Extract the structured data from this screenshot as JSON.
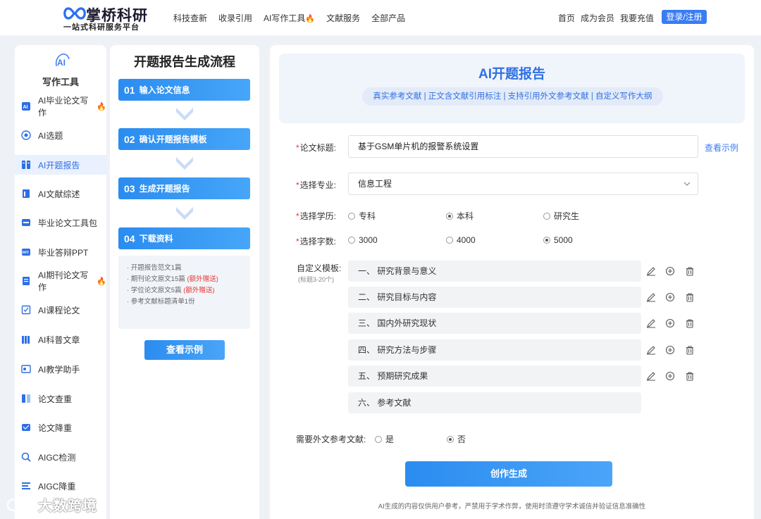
{
  "header": {
    "logo_name": "掌桥科研",
    "logo_slogan": "一站式科研服务平台",
    "nav": [
      {
        "label": "科技查新",
        "fire": false
      },
      {
        "label": "收录引用",
        "fire": false
      },
      {
        "label": "AI写作工具",
        "fire": true
      },
      {
        "label": "文献服务",
        "fire": false
      },
      {
        "label": "全部产品",
        "fire": false
      }
    ],
    "nav_right": [
      "首页",
      "成为会员",
      "我要充值"
    ],
    "login_label": "登录/注册",
    "fire_glyph": "🔥"
  },
  "sidebar": {
    "title": "写作工具",
    "items": [
      {
        "label": "AI毕业论文写作",
        "fire": true,
        "icon": "document-ai-icon",
        "active": false
      },
      {
        "label": "AI选题",
        "fire": false,
        "icon": "target-icon",
        "active": false
      },
      {
        "label": "AI开题报告",
        "fire": false,
        "icon": "report-icon",
        "active": true
      },
      {
        "label": "AI文献综述",
        "fire": false,
        "icon": "literature-icon",
        "active": false
      },
      {
        "label": "毕业论文工具包",
        "fire": false,
        "icon": "toolkit-icon",
        "active": false
      },
      {
        "label": "毕业答辩PPT",
        "fire": false,
        "icon": "ppt-icon",
        "active": false
      },
      {
        "label": "AI期刊论文写作",
        "fire": true,
        "icon": "journal-icon",
        "active": false
      },
      {
        "label": "AI课程论文",
        "fire": false,
        "icon": "course-icon",
        "active": false
      },
      {
        "label": "AI科普文章",
        "fire": false,
        "icon": "books-icon",
        "active": false
      },
      {
        "label": "AI教学助手",
        "fire": false,
        "icon": "teaching-icon",
        "active": false
      },
      {
        "label": "论文查重",
        "fire": false,
        "icon": "check-icon",
        "active": false
      },
      {
        "label": "论文降重",
        "fire": false,
        "icon": "reduce-icon",
        "active": false
      },
      {
        "label": "AIGC检测",
        "fire": false,
        "icon": "magnifier-icon",
        "active": false
      },
      {
        "label": "AIGC降重",
        "fire": false,
        "icon": "lines-icon",
        "active": false
      }
    ]
  },
  "process": {
    "title": "开题报告生成流程",
    "steps": [
      {
        "num": "01",
        "label": "输入论文信息"
      },
      {
        "num": "02",
        "label": "确认开题报告模板"
      },
      {
        "num": "03",
        "label": "生成开题报告"
      },
      {
        "num": "04",
        "label": "下载资料"
      }
    ],
    "resources": [
      {
        "text": "· 开题报告范文1篇",
        "extra": ""
      },
      {
        "text": "· 期刊论文原文15篇",
        "extra": "(额外赠送)"
      },
      {
        "text": "· 学位论文原文5篇",
        "extra": "(额外赠送)"
      },
      {
        "text": "· 参考文献标题清单1份",
        "extra": ""
      }
    ],
    "example_button": "查看示例"
  },
  "main": {
    "title": "AI开题报告",
    "tags": "真实参考文献 | 正文含文献引用标注 | 支持引用外文参考文献 | 自定义写作大纲",
    "thesis_label": "论文标题:",
    "thesis_value": "基于GSM单片机的报警系统设置",
    "example_link": "查看示例",
    "major_label": "选择专业:",
    "major_value": "信息工程",
    "degree_label": "选择学历:",
    "degree_options": [
      {
        "label": "专科",
        "selected": false
      },
      {
        "label": "本科",
        "selected": true
      },
      {
        "label": "研究生",
        "selected": false
      }
    ],
    "words_label": "选择字数:",
    "words_options": [
      {
        "label": "3000",
        "selected": false
      },
      {
        "label": "4000",
        "selected": false
      },
      {
        "label": "5000",
        "selected": true
      }
    ],
    "template_label": "自定义模板:",
    "template_note": "(标题3-20个)",
    "template_items": [
      {
        "text": "一、 研究背景与意义",
        "editable": true
      },
      {
        "text": "二、 研究目标与内容",
        "editable": true
      },
      {
        "text": "三、 国内外研究现状",
        "editable": true
      },
      {
        "text": "四、 研究方法与步骤",
        "editable": true
      },
      {
        "text": "五、 预期研究成果",
        "editable": true
      },
      {
        "text": "六、 参考文献",
        "editable": false
      }
    ],
    "foreign_label": "需要外文参考文献:",
    "foreign_options": [
      {
        "label": "是",
        "selected": false
      },
      {
        "label": "否",
        "selected": true
      }
    ],
    "generate_button": "创作生成",
    "disclaimer": "AI生成的内容仅供用户参考，严禁用于学术作弊，使用时须遵守学术诚信并验证信息准确性"
  },
  "watermark": "大数跨境",
  "colors": {
    "accent": "#3a7cf4",
    "brand": "#2f6fe4",
    "fire": "#ff5a1f",
    "red": "#e53935"
  }
}
